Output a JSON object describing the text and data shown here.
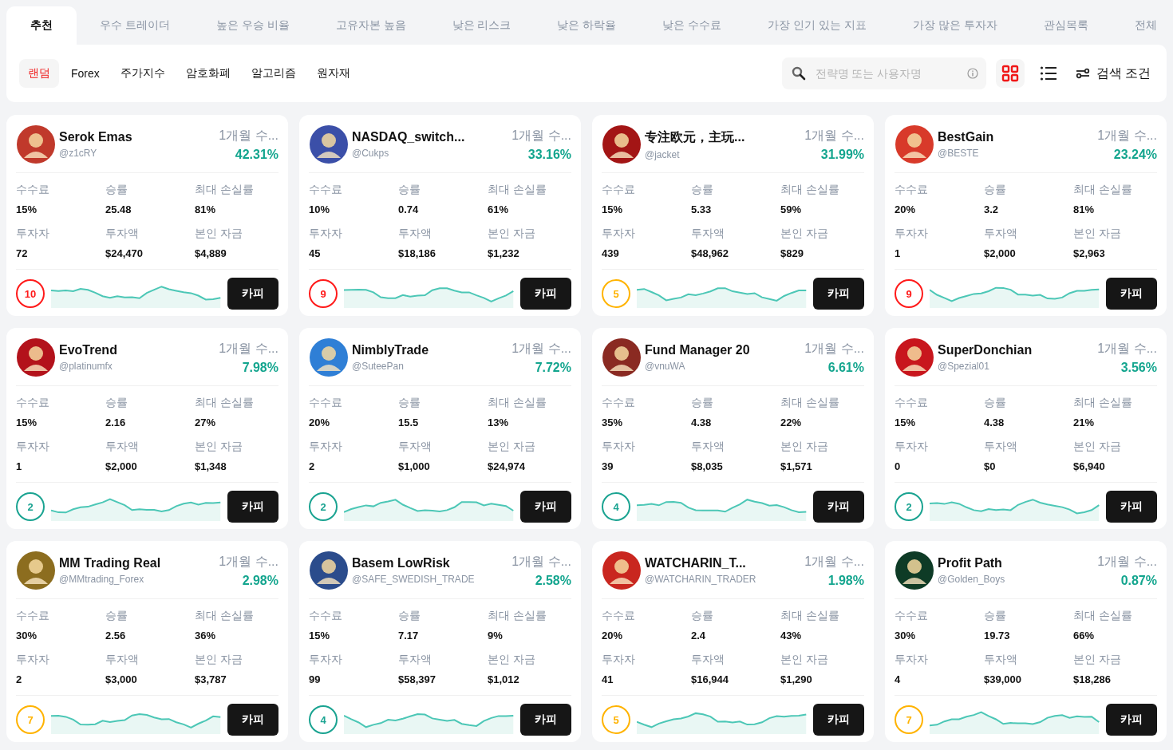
{
  "tabs": [
    {
      "label": "추천",
      "selected": true
    },
    {
      "label": "우수 트레이더",
      "selected": false
    },
    {
      "label": "높은 우승 비율",
      "selected": false
    },
    {
      "label": "고유자본 높음",
      "selected": false
    },
    {
      "label": "낮은 리스크",
      "selected": false
    },
    {
      "label": "낮은 하락율",
      "selected": false
    },
    {
      "label": "낮은 수수료",
      "selected": false
    },
    {
      "label": "가장 인기 있는 지표",
      "selected": false
    },
    {
      "label": "가장 많은 투자자",
      "selected": false
    },
    {
      "label": "관심목록",
      "selected": false
    },
    {
      "label": "전체",
      "selected": false
    }
  ],
  "filters": [
    {
      "label": "랜덤",
      "selected": true
    },
    {
      "label": "Forex",
      "selected": false
    },
    {
      "label": "주가지수",
      "selected": false
    },
    {
      "label": "암호화폐",
      "selected": false
    },
    {
      "label": "알고리즘",
      "selected": false
    },
    {
      "label": "원자재",
      "selected": false
    }
  ],
  "search": {
    "placeholder": "전략명 또는 사용자명"
  },
  "views": [
    {
      "kind": "grid",
      "selected": true
    },
    {
      "kind": "list",
      "selected": false
    }
  ],
  "search_conditions": "검색 조건",
  "cards": [
    {
      "name": "Serok Emas",
      "handle": "@z1cRY",
      "period": "1개월 수...",
      "return": "42.31%",
      "stats": [
        {
          "label": "수수료",
          "value": "15%"
        },
        {
          "label": "승률",
          "value": "25.48"
        },
        {
          "label": "최대 손실률",
          "value": "81%"
        },
        {
          "label": "투자자",
          "value": "72"
        },
        {
          "label": "투자액",
          "value": "$24,470"
        },
        {
          "label": "본인 자금",
          "value": "$4,889"
        }
      ],
      "risk": "10",
      "color": "#ff1a1a",
      "button": "카피"
    },
    {
      "name": "NASDAQ_switch...",
      "handle": "@Cukps",
      "period": "1개월 수...",
      "return": "33.16%",
      "stats": [
        {
          "label": "수수료",
          "value": "10%"
        },
        {
          "label": "승률",
          "value": "0.74"
        },
        {
          "label": "최대 손실률",
          "value": "61%"
        },
        {
          "label": "투자자",
          "value": "45"
        },
        {
          "label": "투자액",
          "value": "$18,186"
        },
        {
          "label": "본인 자금",
          "value": "$1,232"
        }
      ],
      "risk": "9",
      "color": "#ff1a1a",
      "button": "카피"
    },
    {
      "name": "专注欧元，主玩...",
      "handle": "@jacket",
      "period": "1개월 수...",
      "return": "31.99%",
      "stats": [
        {
          "label": "수수료",
          "value": "15%"
        },
        {
          "label": "승률",
          "value": "5.33"
        },
        {
          "label": "최대 손실률",
          "value": "59%"
        },
        {
          "label": "투자자",
          "value": "439"
        },
        {
          "label": "투자액",
          "value": "$48,962"
        },
        {
          "label": "본인 자금",
          "value": "$829"
        }
      ],
      "risk": "5",
      "color": "#ffb300",
      "button": "카피"
    },
    {
      "name": "BestGain",
      "handle": "@BESTE",
      "period": "1개월 수...",
      "return": "23.24%",
      "stats": [
        {
          "label": "수수료",
          "value": "20%"
        },
        {
          "label": "승률",
          "value": "3.2"
        },
        {
          "label": "최대 손실률",
          "value": "81%"
        },
        {
          "label": "투자자",
          "value": "1"
        },
        {
          "label": "투자액",
          "value": "$2,000"
        },
        {
          "label": "본인 자금",
          "value": "$2,963"
        }
      ],
      "risk": "9",
      "color": "#ff1a1a",
      "button": "카피"
    },
    {
      "name": "EvoTrend",
      "handle": "@platinumfx",
      "period": "1개월 수...",
      "return": "7.98%",
      "stats": [
        {
          "label": "수수료",
          "value": "15%"
        },
        {
          "label": "승률",
          "value": "2.16"
        },
        {
          "label": "최대 손실률",
          "value": "27%"
        },
        {
          "label": "투자자",
          "value": "1"
        },
        {
          "label": "투자액",
          "value": "$2,000"
        },
        {
          "label": "본인 자금",
          "value": "$1,348"
        }
      ],
      "risk": "2",
      "color": "#1aa391",
      "button": "카피"
    },
    {
      "name": "NimblyTrade",
      "handle": "@SuteePan",
      "period": "1개월 수...",
      "return": "7.72%",
      "stats": [
        {
          "label": "수수료",
          "value": "20%"
        },
        {
          "label": "승률",
          "value": "15.5"
        },
        {
          "label": "최대 손실률",
          "value": "13%"
        },
        {
          "label": "투자자",
          "value": "2"
        },
        {
          "label": "투자액",
          "value": "$1,000"
        },
        {
          "label": "본인 자금",
          "value": "$24,974"
        }
      ],
      "risk": "2",
      "color": "#1aa391",
      "button": "카피"
    },
    {
      "name": "Fund Manager 20",
      "handle": "@vnuWA",
      "period": "1개월 수...",
      "return": "6.61%",
      "stats": [
        {
          "label": "수수료",
          "value": "35%"
        },
        {
          "label": "승률",
          "value": "4.38"
        },
        {
          "label": "최대 손실률",
          "value": "22%"
        },
        {
          "label": "투자자",
          "value": "39"
        },
        {
          "label": "투자액",
          "value": "$8,035"
        },
        {
          "label": "본인 자금",
          "value": "$1,571"
        }
      ],
      "risk": "4",
      "color": "#1aa391",
      "button": "카피"
    },
    {
      "name": "SuperDonchian",
      "handle": "@Spezial01",
      "period": "1개월 수...",
      "return": "3.56%",
      "stats": [
        {
          "label": "수수료",
          "value": "15%"
        },
        {
          "label": "승률",
          "value": "4.38"
        },
        {
          "label": "최대 손실률",
          "value": "21%"
        },
        {
          "label": "투자자",
          "value": "0"
        },
        {
          "label": "투자액",
          "value": "$0"
        },
        {
          "label": "본인 자금",
          "value": "$6,940"
        }
      ],
      "risk": "2",
      "color": "#1aa391",
      "button": "카피"
    },
    {
      "name": "MM Trading Real",
      "handle": "@MMtrading_Forex",
      "period": "1개월 수...",
      "return": "2.98%",
      "stats": [
        {
          "label": "수수료",
          "value": "30%"
        },
        {
          "label": "승률",
          "value": "2.56"
        },
        {
          "label": "최대 손실률",
          "value": "36%"
        },
        {
          "label": "투자자",
          "value": "2"
        },
        {
          "label": "투자액",
          "value": "$3,000"
        },
        {
          "label": "본인 자금",
          "value": "$3,787"
        }
      ],
      "risk": "7",
      "color": "#ffb300",
      "button": "카피"
    },
    {
      "name": "Basem LowRisk",
      "handle": "@SAFE_SWEDISH_TRADE",
      "period": "1개월 수...",
      "return": "2.58%",
      "stats": [
        {
          "label": "수수료",
          "value": "15%"
        },
        {
          "label": "승률",
          "value": "7.17"
        },
        {
          "label": "최대 손실률",
          "value": "9%"
        },
        {
          "label": "투자자",
          "value": "99"
        },
        {
          "label": "투자액",
          "value": "$58,397"
        },
        {
          "label": "본인 자금",
          "value": "$1,012"
        }
      ],
      "risk": "4",
      "color": "#1aa391",
      "button": "카피"
    },
    {
      "name": "WATCHARIN_T...",
      "handle": "@WATCHARIN_TRADER",
      "period": "1개월 수...",
      "return": "1.98%",
      "stats": [
        {
          "label": "수수료",
          "value": "20%"
        },
        {
          "label": "승률",
          "value": "2.4"
        },
        {
          "label": "최대 손실률",
          "value": "43%"
        },
        {
          "label": "투자자",
          "value": "41"
        },
        {
          "label": "투자액",
          "value": "$16,944"
        },
        {
          "label": "본인 자금",
          "value": "$1,290"
        }
      ],
      "risk": "5",
      "color": "#ffb300",
      "button": "카피"
    },
    {
      "name": "Profit Path",
      "handle": "@Golden_Boys",
      "period": "1개월 수...",
      "return": "0.87%",
      "stats": [
        {
          "label": "수수료",
          "value": "30%"
        },
        {
          "label": "승률",
          "value": "19.73"
        },
        {
          "label": "최대 손실률",
          "value": "66%"
        },
        {
          "label": "투자자",
          "value": "4"
        },
        {
          "label": "투자액",
          "value": "$39,000"
        },
        {
          "label": "본인 자금",
          "value": "$18,286"
        }
      ],
      "risk": "7",
      "color": "#ffb300",
      "button": "카피"
    }
  ]
}
